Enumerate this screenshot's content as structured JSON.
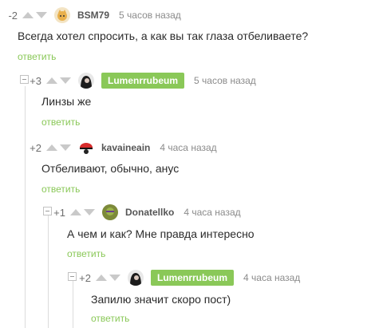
{
  "reply_label": "ответить",
  "colors": {
    "accent": "#8ac858",
    "text": "#2b2b2b",
    "meta": "#8b8b8b"
  },
  "comments": [
    {
      "score": "-2",
      "author": "BSM79",
      "time": "5 часов назад",
      "text": "Всегда хотел спросить, а как вы так глаза отбеливаете?",
      "avatar_icon": "cat-avatar",
      "is_op": false
    },
    {
      "score": "+3",
      "author": "Lumenrrubeum",
      "time": "5 часов назад",
      "text": "Линзы же",
      "avatar_icon": "dark-portrait-avatar",
      "is_op": true
    },
    {
      "score": "+2",
      "author": "kavaineain",
      "time": "4 часа назад",
      "text": "Отбеливают, обычно, анус",
      "avatar_icon": "red-hat-avatar",
      "is_op": false
    },
    {
      "score": "+1",
      "author": "Donatellko",
      "time": "4 часа назад",
      "text": "А чем и как? Мне правда интересно",
      "avatar_icon": "green-avatar",
      "is_op": false
    },
    {
      "score": "+2",
      "author": "Lumenrrubeum",
      "time": "4 часа назад",
      "text": "Запилю значит скоро пост)",
      "avatar_icon": "dark-portrait-avatar",
      "is_op": true
    }
  ]
}
